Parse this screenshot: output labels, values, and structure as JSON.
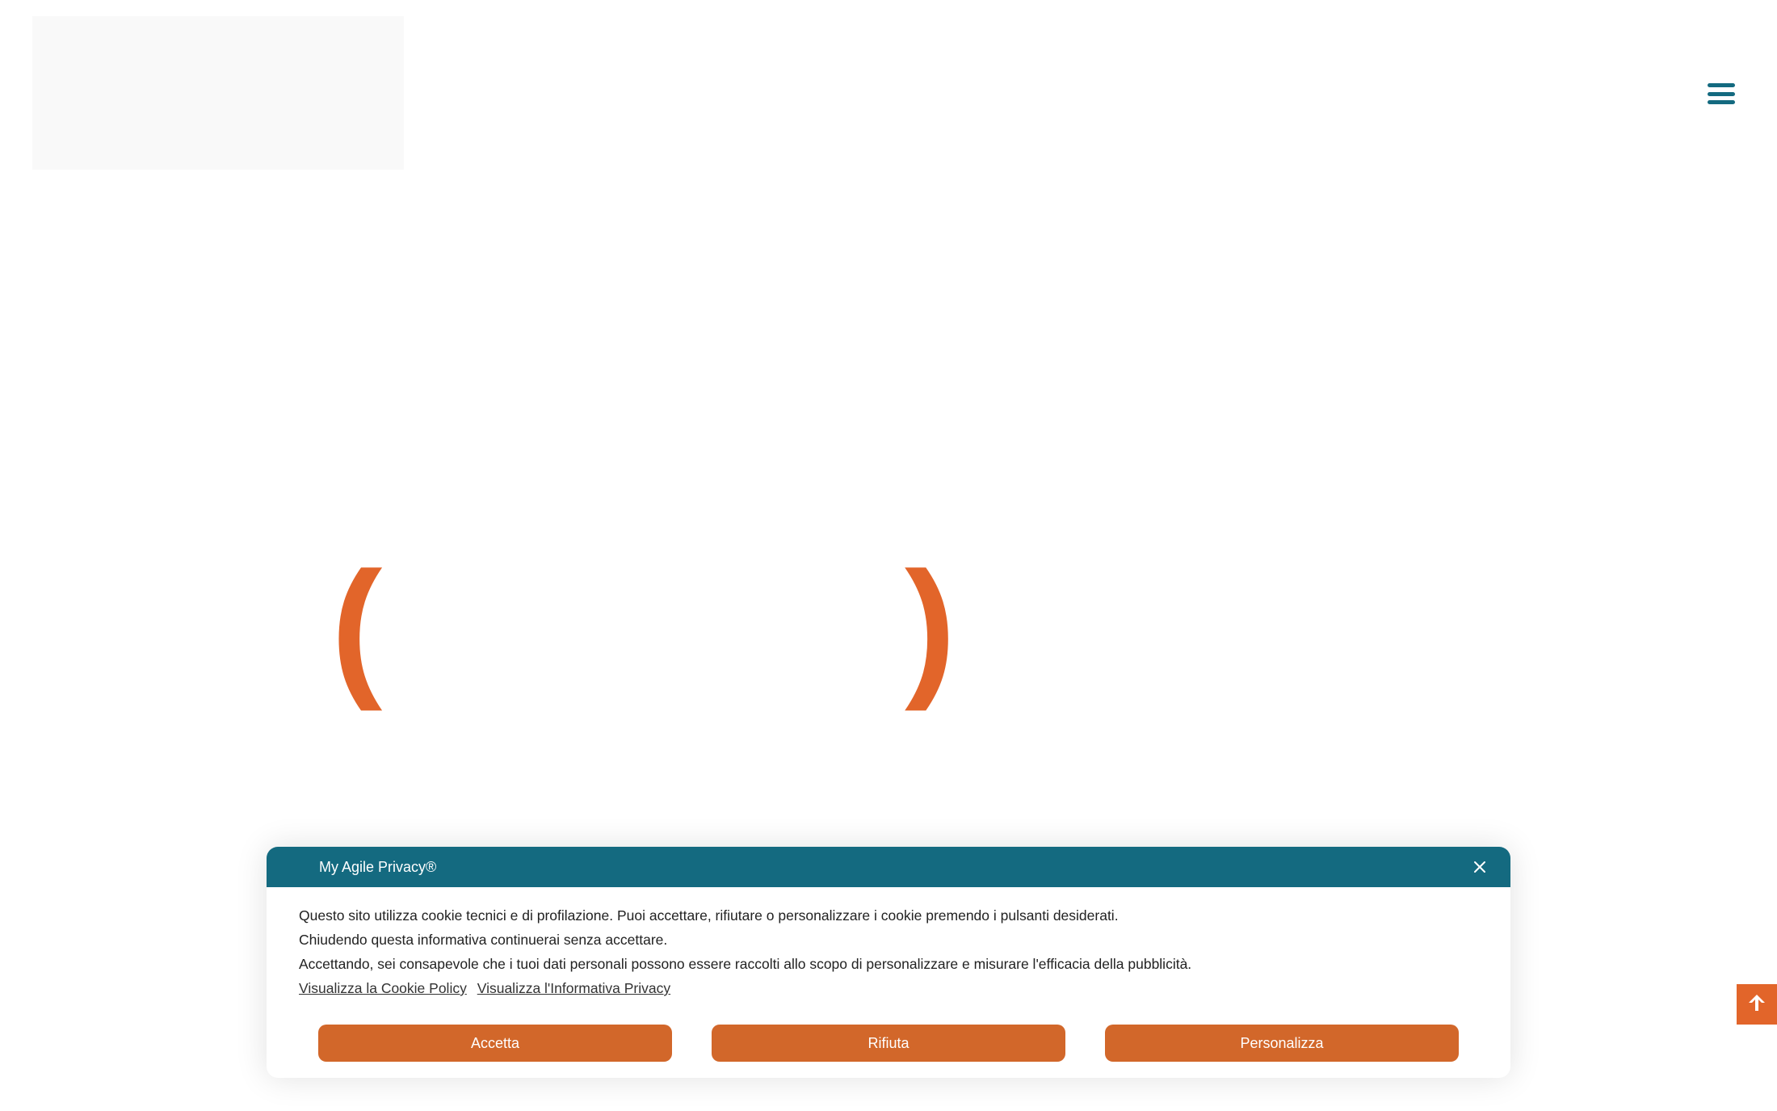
{
  "header": {
    "menu_icon": "hamburger-menu-icon",
    "accent_color": "#146a80"
  },
  "hero": {
    "paren_left": "(",
    "paren_right": ")",
    "paren_color": "#e2652a"
  },
  "scroll_top": {
    "icon": "arrow-up-icon",
    "color": "#e2652a"
  },
  "cookie_banner": {
    "title": "My Agile Privacy®",
    "close_icon": "close-icon",
    "lines": [
      "Questo sito utilizza cookie tecnici e di profilazione. Puoi accettare, rifiutare o personalizzare i cookie premendo i pulsanti desiderati.",
      "Chiudendo questa informativa continuerai senza accettare.",
      "Accettando, sei consapevole che i tuoi dati personali possono essere raccolti allo scopo di personalizzare e misurare l'efficacia della pubblicità."
    ],
    "links": [
      "Visualizza la Cookie Policy",
      "Visualizza l'Informativa Privacy"
    ],
    "buttons": {
      "accept": "Accetta",
      "reject": "Rifiuta",
      "customize": "Personalizza"
    },
    "header_color": "#146a80",
    "button_color": "#d2672a"
  }
}
